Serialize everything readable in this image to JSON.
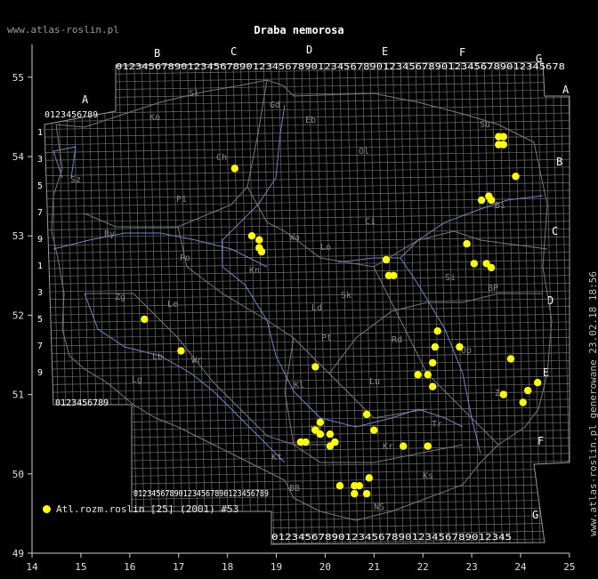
{
  "site_label": "www.atlas-roslin.pl",
  "title": "Draba nemorosa",
  "side_label": "www.atlas-roslin.pl generowane 23.02.18 18:56",
  "legend": {
    "label": "Atl.rozm.roslin [25] (2001) #53",
    "color": "#ffff00"
  },
  "axes": {
    "x_ticks": [
      "14",
      "15",
      "16",
      "17",
      "18",
      "19",
      "20",
      "21",
      "22",
      "23",
      "24",
      "25"
    ],
    "y_ticks": [
      "49",
      "50",
      "51",
      "52",
      "53",
      "54",
      "55"
    ]
  },
  "grid": {
    "column_letters": [
      "A",
      "B",
      "C",
      "D",
      "E",
      "F",
      "G"
    ],
    "row_letters": [
      "A",
      "B",
      "C",
      "D",
      "E",
      "F",
      "G"
    ],
    "top_digits": "012345678901234567890123456789012345678901234567890123456789012345678",
    "bottom_digits_1": "0123456789",
    "bottom_digits_2": "012345678901234567890123456789",
    "bottom_digits_3": "012345678901234567890123456789012345"
  },
  "region_codes": [
    "Sl",
    "Ko",
    "Gd",
    "Eb",
    "Ch",
    "Ol",
    "Pi",
    "Su",
    "Ci",
    "Sz",
    "By",
    "Wa",
    "Ld",
    "Po",
    "Lo",
    "Bi",
    "Sk",
    "Kn",
    "Pt",
    "Rd",
    "Zg",
    "Le",
    "Si",
    "BP",
    "Lb",
    "Op",
    "Kl",
    "Lu",
    "Wr",
    "Ka",
    "Kr",
    "Tr",
    "Za",
    "BB",
    "NS",
    "Ks",
    "Kt",
    "Lg"
  ],
  "points": [
    [
      18.15,
      53.85
    ],
    [
      18.5,
      53.0
    ],
    [
      18.65,
      52.95
    ],
    [
      18.65,
      52.85
    ],
    [
      18.7,
      52.8
    ],
    [
      16.3,
      51.95
    ],
    [
      17.05,
      51.55
    ],
    [
      19.8,
      51.35
    ],
    [
      21.25,
      52.7
    ],
    [
      21.3,
      52.5
    ],
    [
      21.4,
      52.5
    ],
    [
      23.55,
      54.25
    ],
    [
      23.65,
      54.25
    ],
    [
      23.55,
      54.15
    ],
    [
      23.65,
      54.15
    ],
    [
      23.9,
      53.75
    ],
    [
      23.2,
      53.45
    ],
    [
      23.35,
      53.5
    ],
    [
      23.4,
      53.45
    ],
    [
      22.9,
      52.9
    ],
    [
      23.05,
      52.65
    ],
    [
      23.3,
      52.65
    ],
    [
      23.4,
      52.6
    ],
    [
      22.3,
      51.8
    ],
    [
      22.25,
      51.6
    ],
    [
      22.75,
      51.6
    ],
    [
      22.2,
      51.4
    ],
    [
      23.8,
      51.45
    ],
    [
      21.9,
      51.25
    ],
    [
      22.1,
      51.25
    ],
    [
      22.2,
      51.1
    ],
    [
      23.65,
      51.0
    ],
    [
      24.05,
      50.9
    ],
    [
      24.15,
      51.05
    ],
    [
      24.35,
      51.15
    ],
    [
      20.85,
      50.75
    ],
    [
      21.0,
      50.55
    ],
    [
      21.6,
      50.35
    ],
    [
      22.1,
      50.35
    ],
    [
      19.5,
      50.4
    ],
    [
      19.6,
      50.4
    ],
    [
      19.8,
      50.55
    ],
    [
      19.9,
      50.65
    ],
    [
      19.9,
      50.5
    ],
    [
      20.1,
      50.5
    ],
    [
      20.1,
      50.35
    ],
    [
      20.2,
      50.4
    ],
    [
      20.3,
      49.85
    ],
    [
      20.6,
      49.85
    ],
    [
      20.7,
      49.85
    ],
    [
      20.6,
      49.75
    ],
    [
      20.85,
      49.75
    ],
    [
      20.9,
      49.95
    ]
  ]
}
